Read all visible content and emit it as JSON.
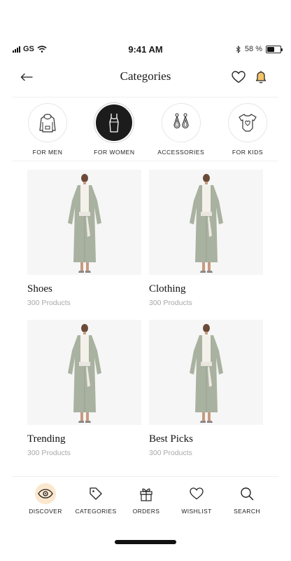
{
  "status_bar": {
    "carrier": "GS",
    "time": "9:41 AM",
    "battery": "58 %",
    "battery_level": 0.58
  },
  "header": {
    "title": "Categories"
  },
  "categories": [
    {
      "label": "FOR MEN",
      "icon": "hoodie-icon",
      "active": false
    },
    {
      "label": "FOR WOMEN",
      "icon": "dress-icon",
      "active": true
    },
    {
      "label": "ACCESSORIES",
      "icon": "earrings-icon",
      "active": false
    },
    {
      "label": "FOR KIDS",
      "icon": "onesie-icon",
      "active": false
    }
  ],
  "products": [
    {
      "name": "Shoes",
      "count": "300 Products"
    },
    {
      "name": "Clothing",
      "count": "300 Products"
    },
    {
      "name": "Trending",
      "count": "300 Products"
    },
    {
      "name": "Best Picks",
      "count": "300 Products"
    }
  ],
  "bottom_nav": [
    {
      "label": "DISCOVER",
      "icon": "eye-icon",
      "active": true
    },
    {
      "label": "CATEGORIES",
      "icon": "tag-icon",
      "active": false
    },
    {
      "label": "ORDERS",
      "icon": "gift-icon",
      "active": false
    },
    {
      "label": "WISHLIST",
      "icon": "heart-icon",
      "active": false
    },
    {
      "label": "SEARCH",
      "icon": "search-icon",
      "active": false
    }
  ],
  "colors": {
    "accent": "#fbe7cd",
    "bell": "#e0a12a",
    "dark": "#1c1c1c",
    "muted": "#a8a8a8",
    "garment": "#a9b2a0"
  }
}
